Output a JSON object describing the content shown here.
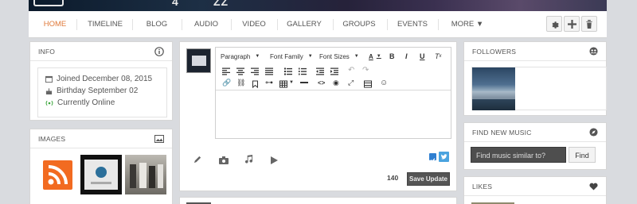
{
  "header": {
    "glyphs": [
      "4",
      "ZZ"
    ]
  },
  "nav": {
    "items": [
      {
        "label": "HOME",
        "active": true
      },
      {
        "label": "TIMELINE"
      },
      {
        "label": "BLOG"
      },
      {
        "label": "AUDIO"
      },
      {
        "label": "VIDEO"
      },
      {
        "label": "GALLERY"
      },
      {
        "label": "GROUPS"
      },
      {
        "label": "EVENTS"
      },
      {
        "label": "MORE ▼"
      }
    ],
    "actions": [
      "gear-icon",
      "plus-icon",
      "trash-icon"
    ],
    "accent": "#e07a3a"
  },
  "info": {
    "title": "INFO",
    "joined": "Joined December 08, 2015",
    "birthday": "Birthday September 02",
    "status": "Currently Online",
    "status_color": "#3aa53a"
  },
  "images": {
    "title": "IMAGES"
  },
  "editor": {
    "paragraph": "Paragraph",
    "font_family": "Font Family",
    "font_sizes": "Font Sizes",
    "char_count": "140",
    "save_label": "Save Update"
  },
  "followers": {
    "title": "FOLLOWERS"
  },
  "find_music": {
    "title": "FIND NEW MUSIC",
    "placeholder": "Find music similar to?",
    "button": "Find"
  },
  "likes": {
    "title": "LIKES"
  }
}
